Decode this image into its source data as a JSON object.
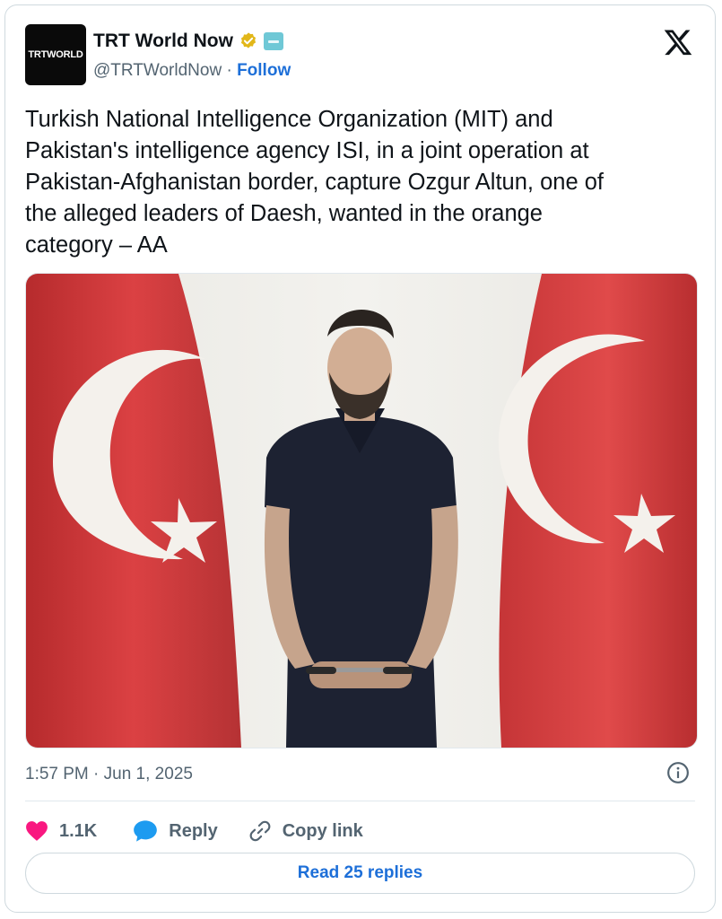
{
  "author": {
    "avatar_text": "TRTWORLD",
    "name": "TRT World Now",
    "handle": "@TRTWorldNow",
    "separator": " · ",
    "follow_label": "Follow"
  },
  "tweet": {
    "text": "Turkish National Intelligence Organization (MIT) and\nPakistan's intelligence agency ISI, in a joint operation at\nPakistan-Afghanistan border, capture Ozgur Altun, one of\nthe alleged leaders of Daesh, wanted in the orange\ncategory – AA",
    "timestamp": "1:57 PM · Jun 1, 2025"
  },
  "actions": {
    "likes": "1.1K",
    "reply_label": "Reply",
    "copy_link_label": "Copy link",
    "read_replies_label": "Read 25 replies"
  },
  "icons": {
    "verified": "verified-badge-icon",
    "affiliate": "affiliate-badge-icon",
    "logo": "x-logo-icon",
    "info": "info-icon",
    "like": "heart-icon",
    "reply": "reply-bubble-icon",
    "link": "link-icon"
  },
  "colors": {
    "follow": "#1d6fd8",
    "heart": "#f91880",
    "reply_bubble": "#1d9bf0",
    "verified_gold": "#e2b719",
    "flag_red": "#d5393a"
  }
}
